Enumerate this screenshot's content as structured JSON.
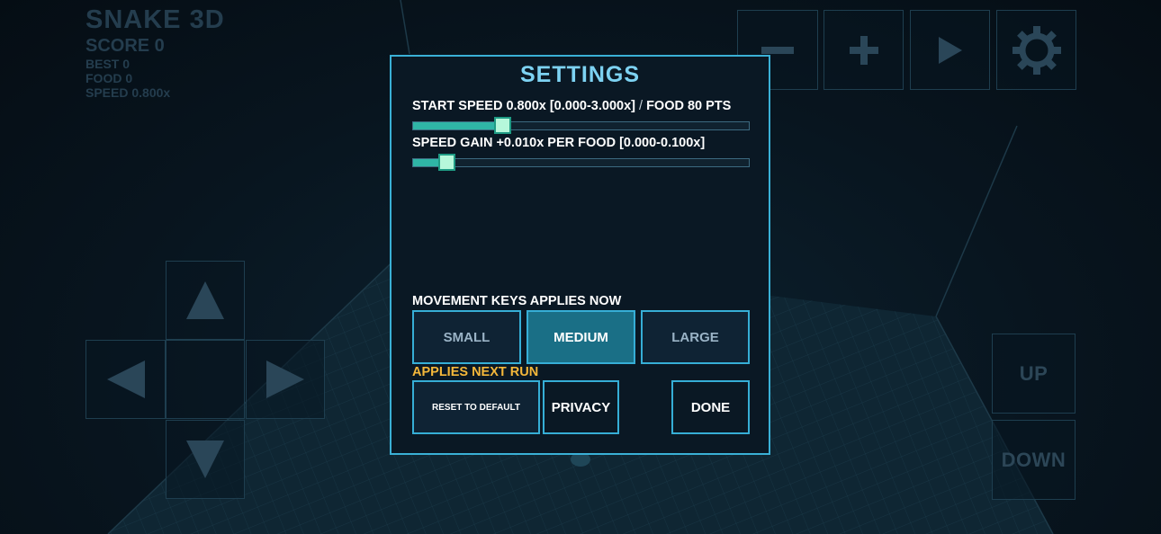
{
  "hud": {
    "title": "SNAKE 3D",
    "score": "SCORE 0",
    "best": "BEST 0",
    "food": "FOOD 0",
    "speed": "SPEED 0.800x"
  },
  "toolbar": {
    "zoom_out_icon": "minus-icon",
    "zoom_in_icon": "plus-icon",
    "play_icon": "play-icon",
    "settings_icon": "gear-icon"
  },
  "dpad": {
    "up_icon": "arrow-up-icon",
    "left_icon": "arrow-left-icon",
    "right_icon": "arrow-right-icon",
    "down_icon": "arrow-down-icon"
  },
  "vertical": {
    "up_label": "UP",
    "down_label": "DOWN"
  },
  "settings": {
    "title": "SETTINGS",
    "start_speed": {
      "label": "START SPEED 0.800x [0.000-3.000x]",
      "separator": "/",
      "food_label": "FOOD 80 PTS",
      "value": 0.8,
      "min": 0.0,
      "max": 3.0
    },
    "speed_gain": {
      "label": "SPEED GAIN +0.010x PER FOOD [0.000-0.100x]",
      "value": 0.01,
      "min": 0.0,
      "max": 0.1
    },
    "movement_keys": {
      "label": "MOVEMENT KEYS  APPLIES NOW",
      "options": [
        "SMALL",
        "MEDIUM",
        "LARGE"
      ],
      "selected": "MEDIUM"
    },
    "applies_next_run": "APPLIES NEXT RUN",
    "reset_label": "RESET TO DEFAULT",
    "privacy_label": "PRIVACY",
    "done_label": "DONE"
  },
  "colors": {
    "accent": "#3ab0d6",
    "title": "#7dd2f2",
    "slider_fill": "#2fb5a6",
    "warning": "#f4b73a",
    "selected": "#1a6f86"
  }
}
